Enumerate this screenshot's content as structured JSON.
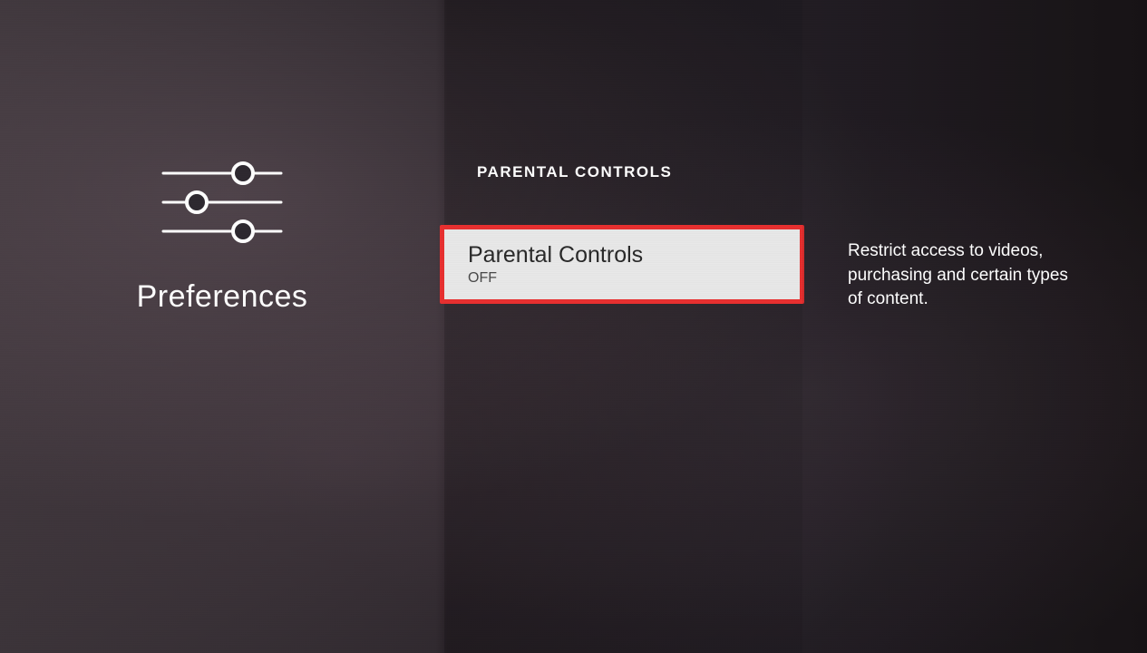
{
  "sidebar": {
    "title": "Preferences"
  },
  "section": {
    "header": "PARENTAL CONTROLS"
  },
  "menu_item": {
    "title": "Parental Controls",
    "status": "OFF"
  },
  "description": "Restrict access to videos, purchasing and certain types of content."
}
